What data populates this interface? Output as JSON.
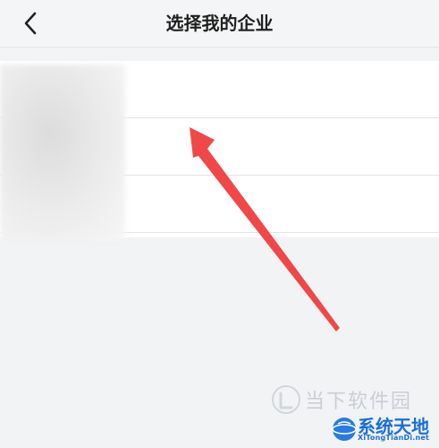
{
  "header": {
    "title": "选择我的企业",
    "back_icon": "chevron-left-icon"
  },
  "company_list": {
    "rows": [
      {
        "name": ""
      },
      {
        "name": ""
      },
      {
        "name": ""
      }
    ]
  },
  "annotation": {
    "color": "#f04848"
  },
  "watermarks": {
    "top_text": "当下软件园",
    "bottom_main": "系统天地",
    "bottom_sub": "XiTongTianDi.net"
  }
}
